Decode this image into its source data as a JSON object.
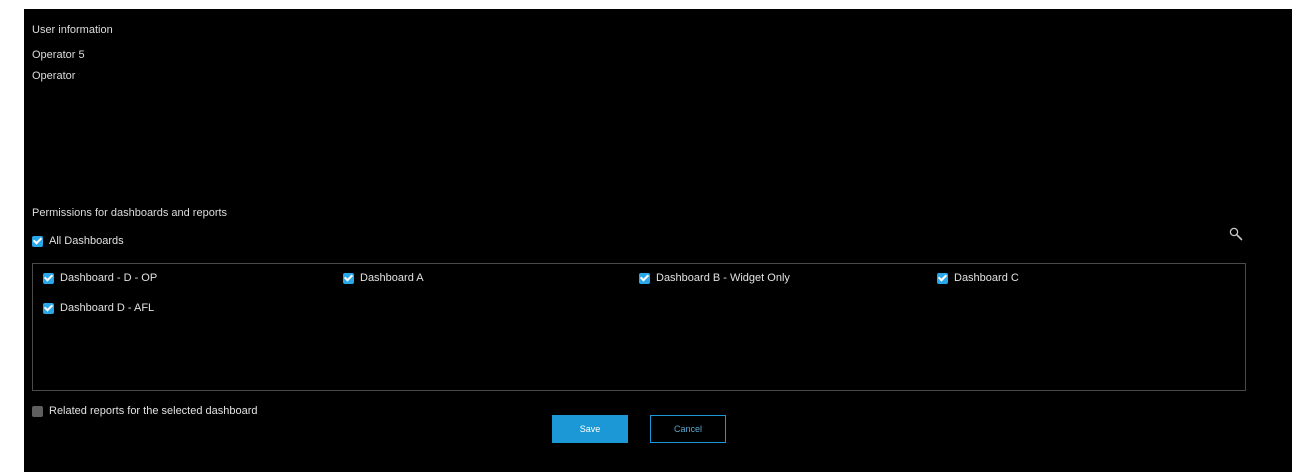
{
  "user": {
    "section_title": "User information",
    "name": "Operator 5",
    "role": "Operator"
  },
  "permissions": {
    "section_title": "Permissions for dashboards and reports",
    "all_dashboards": {
      "label": "All Dashboards",
      "checked": true
    },
    "search_icon": "magnifier-icon",
    "dashboards": [
      {
        "label": "Dashboard - D - OP",
        "checked": true
      },
      {
        "label": "Dashboard A",
        "checked": true
      },
      {
        "label": "Dashboard B - Widget Only",
        "checked": true
      },
      {
        "label": "Dashboard C",
        "checked": true
      },
      {
        "label": "Dashboard D - AFL",
        "checked": true
      }
    ],
    "related_reports": {
      "label": "Related reports for the selected dashboard",
      "checked": false
    }
  },
  "actions": {
    "save_label": "Save",
    "cancel_label": "Cancel"
  },
  "colors": {
    "accent": "#1b98d5",
    "checkbox_on": "#2aa7e8",
    "checkbox_off": "#5f5f5f",
    "background": "#000000"
  }
}
